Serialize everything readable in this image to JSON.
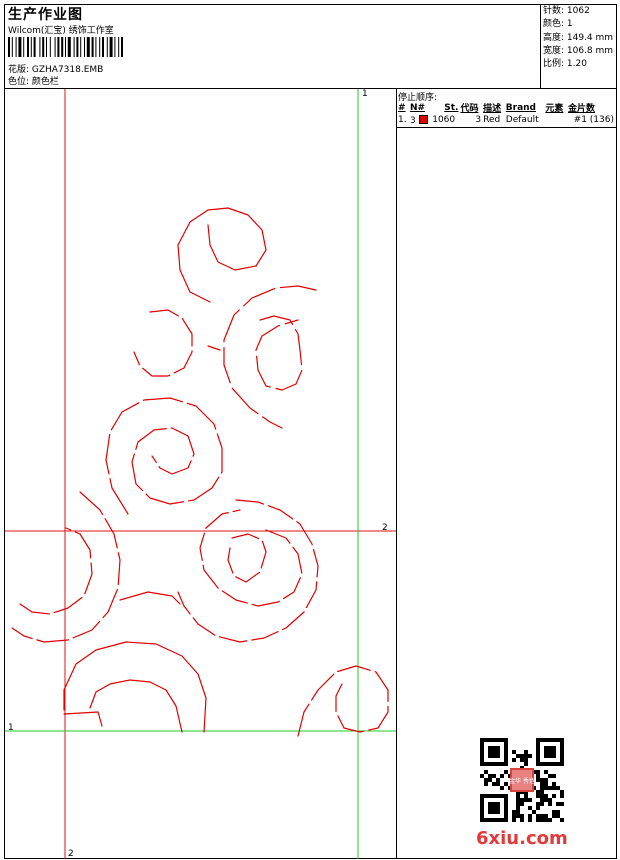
{
  "header": {
    "title": "生产作业图",
    "company": "Wilcom(汇宝) 绣饰工作室",
    "design": "花版: GZHA7318.EMB",
    "color": "色位: 颜色栏"
  },
  "info": [
    "针数: 1062",
    "颜色: 1",
    "高度: 149.4 mm",
    "宽度: 106.8 mm",
    "比例: 1.20"
  ],
  "stop_sequence": {
    "title": "停止顺序:",
    "columns": [
      "#",
      "N#",
      "St.",
      "代码",
      "描述",
      "Brand",
      "元素",
      "金片数"
    ],
    "rows": [
      {
        "n": "1.",
        "num": "3",
        "swatch": "#e00000",
        "stitches": "1060",
        "code": "3",
        "desc": "Red",
        "brand": "Default",
        "elements": "",
        "sequin": "#1 (136)"
      }
    ]
  },
  "guides": {
    "red_vertical": "2",
    "red_horizontal": "2",
    "green_vertical": "1",
    "green_horizontal": "1"
  },
  "colors": {
    "stitch": "#e00000",
    "guide_red": "#e01010",
    "guide_green": "#22cc22"
  },
  "watermark": "6xiu.com",
  "seal": "金华 秀色"
}
